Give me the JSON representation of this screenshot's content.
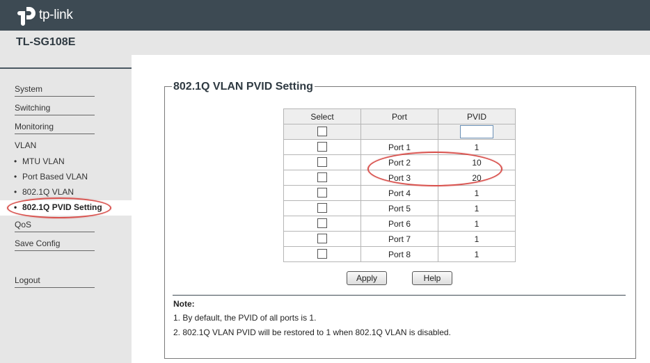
{
  "brand": {
    "name": "tp-link"
  },
  "device": {
    "model": "TL-SG108E"
  },
  "sidebar": {
    "items": [
      {
        "label": "System"
      },
      {
        "label": "Switching"
      },
      {
        "label": "Monitoring"
      },
      {
        "label": "VLAN"
      }
    ],
    "vlan_sub": [
      {
        "label": "MTU VLAN"
      },
      {
        "label": "Port Based VLAN"
      },
      {
        "label": "802.1Q VLAN"
      },
      {
        "label": "802.1Q PVID Setting",
        "active": true
      }
    ],
    "after": [
      {
        "label": "QoS"
      },
      {
        "label": "Save Config"
      }
    ],
    "logout": "Logout"
  },
  "main": {
    "title": "802.1Q VLAN PVID Setting",
    "table": {
      "headers": {
        "select": "Select",
        "port": "Port",
        "pvid": "PVID"
      },
      "filter_pvid_value": "",
      "rows": [
        {
          "port": "Port 1",
          "pvid": "1"
        },
        {
          "port": "Port 2",
          "pvid": "10"
        },
        {
          "port": "Port 3",
          "pvid": "20"
        },
        {
          "port": "Port 4",
          "pvid": "1"
        },
        {
          "port": "Port 5",
          "pvid": "1"
        },
        {
          "port": "Port 6",
          "pvid": "1"
        },
        {
          "port": "Port 7",
          "pvid": "1"
        },
        {
          "port": "Port 8",
          "pvid": "1"
        }
      ]
    },
    "buttons": {
      "apply": "Apply",
      "help": "Help"
    },
    "note": {
      "title": "Note:",
      "lines": [
        "1. By default, the PVID of all ports is 1.",
        "2. 802.1Q VLAN PVID will be restored to 1 when 802.1Q VLAN is disabled."
      ]
    }
  },
  "colors": {
    "header_bg": "#3d4a53",
    "sidebar_bg": "#e6e6e6",
    "highlight_ellipse": "#d9534f"
  }
}
